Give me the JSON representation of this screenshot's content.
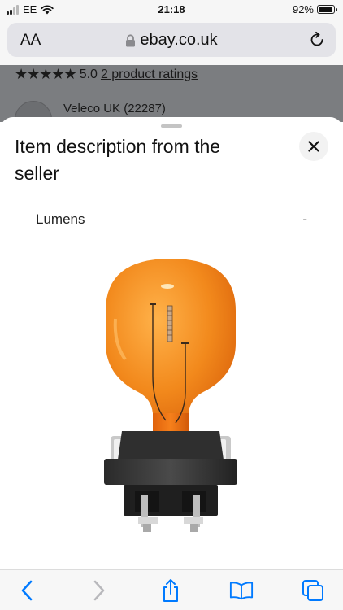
{
  "status_bar": {
    "carrier": "EE",
    "time": "21:18",
    "battery": "92%",
    "battery_level": 0.92,
    "signal_bars": 2
  },
  "address_bar": {
    "text_size_label": "AA",
    "url": "ebay.co.uk"
  },
  "background_page": {
    "rating_stars": "★★★★★",
    "rating_value": "5.0",
    "ratings_link": "2 product ratings",
    "seller": "Veleco UK (22287)"
  },
  "sheet": {
    "title": "Item description from the seller",
    "specs": [
      {
        "label": "Lumens",
        "value": "-"
      }
    ]
  },
  "icons": {
    "back": "chevron-left-icon",
    "forward": "chevron-right-icon",
    "share": "share-icon",
    "bookmarks": "book-icon",
    "tabs": "tabs-icon",
    "close": "close-icon",
    "lock": "lock-icon",
    "reload": "reload-icon"
  },
  "colors": {
    "accent": "#007aff",
    "bulb_amber": "#f08a1c",
    "overlay": "#7b7d80"
  }
}
